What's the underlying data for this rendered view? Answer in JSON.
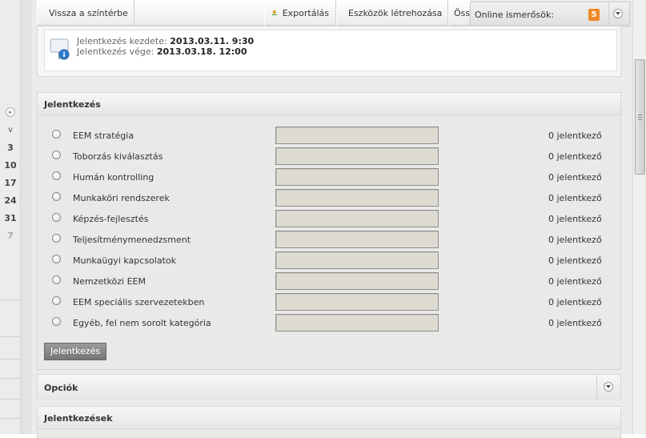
{
  "calendar": {
    "weekday_header": "v",
    "days": [
      "3",
      "10",
      "17",
      "24",
      "31",
      "7"
    ]
  },
  "toolbar": {
    "back_label": "Vissza a színtérbe",
    "export_label": "Exportálás",
    "create_tools_label": "Eszközök létrehozása",
    "truncated_label": "Öss"
  },
  "online": {
    "label": "Online ismerősök:",
    "count": "5"
  },
  "info": {
    "start_label": "Jelentkezés kezdete:",
    "start_value": "2013.03.11. 9:30",
    "end_label": "Jelentkezés vége:",
    "end_value": "2013.03.18. 12:00"
  },
  "signup_panel": {
    "title": "Jelentkezés",
    "categories": [
      {
        "name": "EEM stratégia",
        "count": "0 jelentkező"
      },
      {
        "name": "Toborzás kiválasztás",
        "count": "0 jelentkező"
      },
      {
        "name": "Humán kontrolling",
        "count": "0 jelentkező"
      },
      {
        "name": "Munkaköri rendszerek",
        "count": "0 jelentkező"
      },
      {
        "name": "Képzés-fejlesztés",
        "count": "0 jelentkező"
      },
      {
        "name": "Teljesítménymenedzsment",
        "count": "0 jelentkező"
      },
      {
        "name": "Munkaügyi kapcsolatok",
        "count": "0 jelentkező"
      },
      {
        "name": "Nemzetközi EEM",
        "count": "0 jelentkező"
      },
      {
        "name": "EEM speciális szervezetekben",
        "count": "0 jelentkező"
      },
      {
        "name": "Egyéb, fel nem sorolt kategória",
        "count": "0 jelentkező"
      }
    ],
    "submit_label": "Jelentkezés"
  },
  "options_panel": {
    "title": "Opciók"
  },
  "signups_panel": {
    "title": "Jelentkezések"
  },
  "colors": {
    "accent_badge": "#f08a24",
    "back_arrow": "#3aa02a",
    "add_icon": "#4cae3c"
  },
  "icons": {
    "back": "arrow-left-icon",
    "export": "download-icon",
    "create": "plus-icon",
    "info": "info-board-icon",
    "collapse": "chevron-down-icon"
  }
}
